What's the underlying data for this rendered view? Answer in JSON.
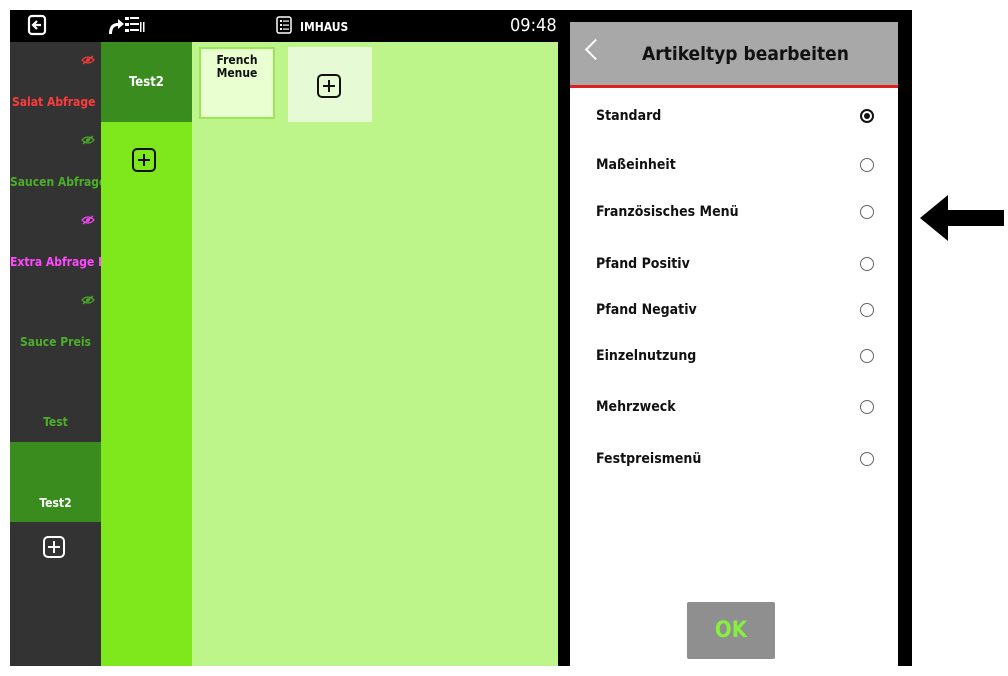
{
  "topbar": {
    "exit_icon": "logout-icon",
    "order_icon": "redirect-list-icon",
    "mode_icon": "list-icon",
    "mode_label": "IMHAUS",
    "time": "09:48"
  },
  "categories": [
    {
      "label": "Salat Abfrage",
      "color": "#ff3b3b",
      "eye_color": "#ff3b3b"
    },
    {
      "label": "Saucen Abfrage",
      "color": "#4caf2a",
      "eye_color": "#4caf2a"
    },
    {
      "label": "Extra Abfrage Kl",
      "color": "#ff48ff",
      "eye_color": "#ff48ff"
    },
    {
      "label": "Sauce Preis",
      "color": "#4caf2a",
      "eye_color": "#4caf2a"
    },
    {
      "label": "Test",
      "color": "#4caf2a"
    },
    {
      "label": "Test2",
      "color": "#ffffff",
      "active_bg": "#3a8c1e"
    }
  ],
  "subcategories": [
    {
      "label": "Test2"
    }
  ],
  "products": [
    {
      "label_line1": "French",
      "label_line2": "Menue"
    }
  ],
  "panel": {
    "title": "Artikeltyp bearbeiten",
    "options": [
      {
        "label": "Standard",
        "selected": true
      },
      {
        "label": "Maßeinheit",
        "selected": false
      },
      {
        "label": "Französisches Menü",
        "selected": false
      },
      {
        "label": "Pfand Positiv",
        "selected": false
      },
      {
        "label": "Pfand Negativ",
        "selected": false
      },
      {
        "label": "Einzelnutzung",
        "selected": false
      },
      {
        "label": "Mehrzweck",
        "selected": false
      },
      {
        "label": "Festpreismenü",
        "selected": false
      }
    ],
    "ok_label": "OK"
  },
  "colors": {
    "accent_green": "#7fe81c",
    "dark_green": "#3a8c1e",
    "header_red": "#e02020"
  }
}
